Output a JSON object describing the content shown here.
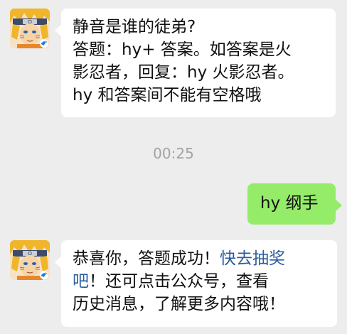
{
  "messages": [
    {
      "sender": "official-account",
      "avatar_icon": "naruto-game-avatar-icon",
      "lines": [
        "静音是谁的徒弟?",
        "答题：hy+ 答案。如答案是火",
        "影忍者，回复：hy 火影忍者。",
        "hy 和答案间不能有空格哦"
      ]
    },
    {
      "timestamp": "00:25"
    },
    {
      "sender": "me",
      "text": "hy 纲手"
    },
    {
      "sender": "official-account",
      "avatar_icon": "naruto-game-avatar-icon",
      "line1_prefix": "恭喜你，答题成功！",
      "line1_link": "快去抽奖",
      "line2_link": "吧",
      "line2_suffix": "！还可点击公众号，查看",
      "line3": "历史消息，了解更多内容哦！"
    }
  ],
  "colors": {
    "background": "#ededed",
    "bubble_received": "#ffffff",
    "bubble_sent": "#95ec69",
    "link": "#2a5d9f",
    "timestamp": "#a3a3a3"
  }
}
